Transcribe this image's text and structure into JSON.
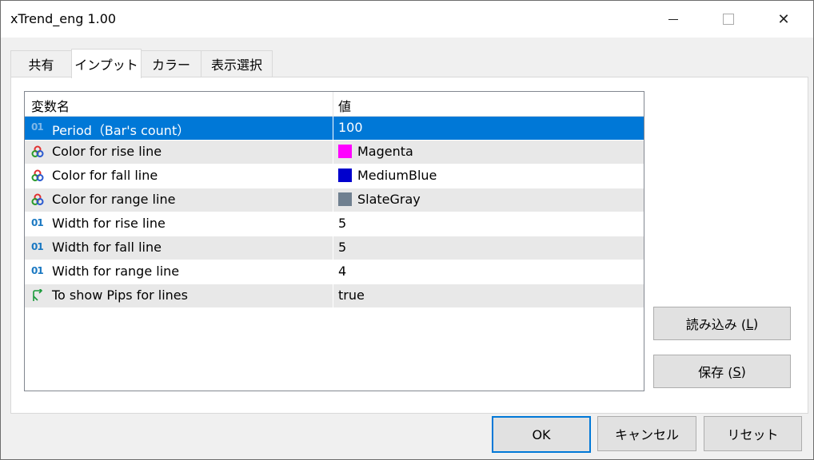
{
  "window": {
    "title": "xTrend_eng 1.00"
  },
  "tabs": [
    {
      "label": "共有"
    },
    {
      "label": "インプット"
    },
    {
      "label": "カラー"
    },
    {
      "label": "表示選択"
    }
  ],
  "grid": {
    "columns": [
      "変数名",
      "値"
    ],
    "rows": [
      {
        "name": "Period（Bar's count）",
        "value": "100",
        "icon": "numeric-icon"
      },
      {
        "name": "Color for rise line",
        "value": "Magenta",
        "icon": "color-icon",
        "swatch": "#ff00ff"
      },
      {
        "name": "Color for fall line",
        "value": "MediumBlue",
        "icon": "color-icon",
        "swatch": "#0000cd"
      },
      {
        "name": "Color for range line",
        "value": "SlateGray",
        "icon": "color-icon",
        "swatch": "#708090"
      },
      {
        "name": "Width for rise line",
        "value": "5",
        "icon": "numeric-icon"
      },
      {
        "name": "Width for fall line",
        "value": "5",
        "icon": "numeric-icon"
      },
      {
        "name": "Width for range line",
        "value": "4",
        "icon": "numeric-icon"
      },
      {
        "name": "To show Pips for lines",
        "value": "true",
        "icon": "boolean-icon"
      }
    ]
  },
  "side_buttons": {
    "load_text": "読み込み (",
    "load_key": "L",
    "load_end": ")",
    "save_text": "保存 (",
    "save_key": "S",
    "save_end": ")"
  },
  "bottom_buttons": {
    "ok": "OK",
    "cancel": "キャンセル",
    "reset": "リセット"
  },
  "colors": {
    "selection": "#0078d7",
    "accent_border": "#0078d7"
  }
}
